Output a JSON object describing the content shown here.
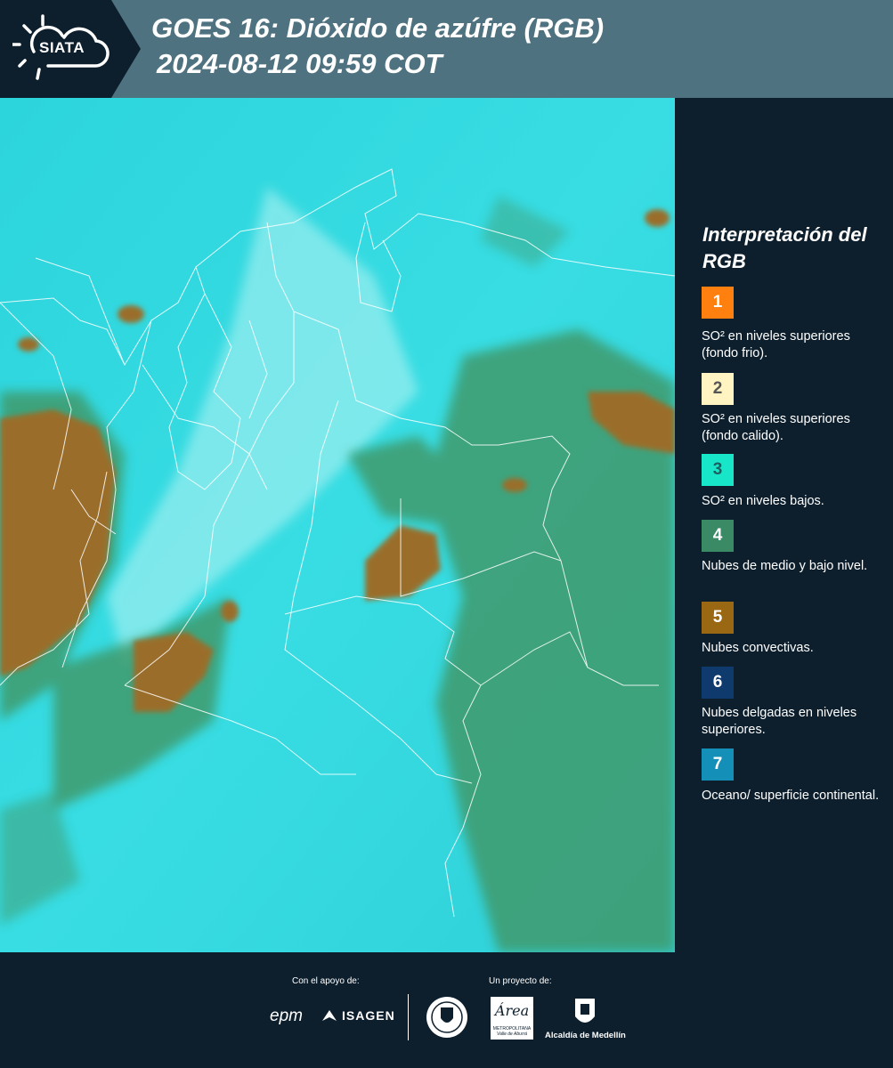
{
  "header": {
    "logo_text": "SIATA",
    "title_line1": "GOES 16: Dióxido de azúfre (RGB)",
    "title_line2": "2024-08-12 09:59 COT"
  },
  "legend": {
    "title": "Interpretación del RGB",
    "items": [
      {
        "number": "1",
        "color": "#ff7f0f",
        "text_color": "#ffffff",
        "description": "SO² en niveles superiores (fondo frio)."
      },
      {
        "number": "2",
        "color": "#fff4c2",
        "text_color": "#555555",
        "description": "SO² en niveles superiores (fondo calido)."
      },
      {
        "number": "3",
        "color": "#17e6c8",
        "text_color": "#1f5f5f",
        "description": "SO² en niveles bajos."
      },
      {
        "number": "4",
        "color": "#3a8a66",
        "text_color": "#ffffff",
        "description": "Nubes de medio y bajo nivel."
      },
      {
        "number": "5",
        "color": "#9a6712",
        "text_color": "#ffffff",
        "description": "Nubes convectivas."
      },
      {
        "number": "6",
        "color": "#0e3a6e",
        "text_color": "#ffffff",
        "description": "Nubes delgadas en niveles superiores."
      },
      {
        "number": "7",
        "color": "#138fb8",
        "text_color": "#ffffff",
        "description": "Oceano/ superficie continental."
      }
    ]
  },
  "footer": {
    "support_label": "Con el apoyo de:",
    "project_label": "Un proyecto de:",
    "sponsor_epm": "epm",
    "sponsor_isagen": "ISAGEN",
    "sponsor_area": "Área",
    "sponsor_area_sub": "METROPOLITANA",
    "sponsor_area_sub2": "Valle de Aburrá",
    "sponsor_alcaldia": "Alcaldía de Medellín"
  },
  "map": {
    "background_color": "#2fd6df",
    "convective_color": "#9a6e2c",
    "midlevel_color": "#3f9a6c",
    "border_color": "#ffffff"
  }
}
